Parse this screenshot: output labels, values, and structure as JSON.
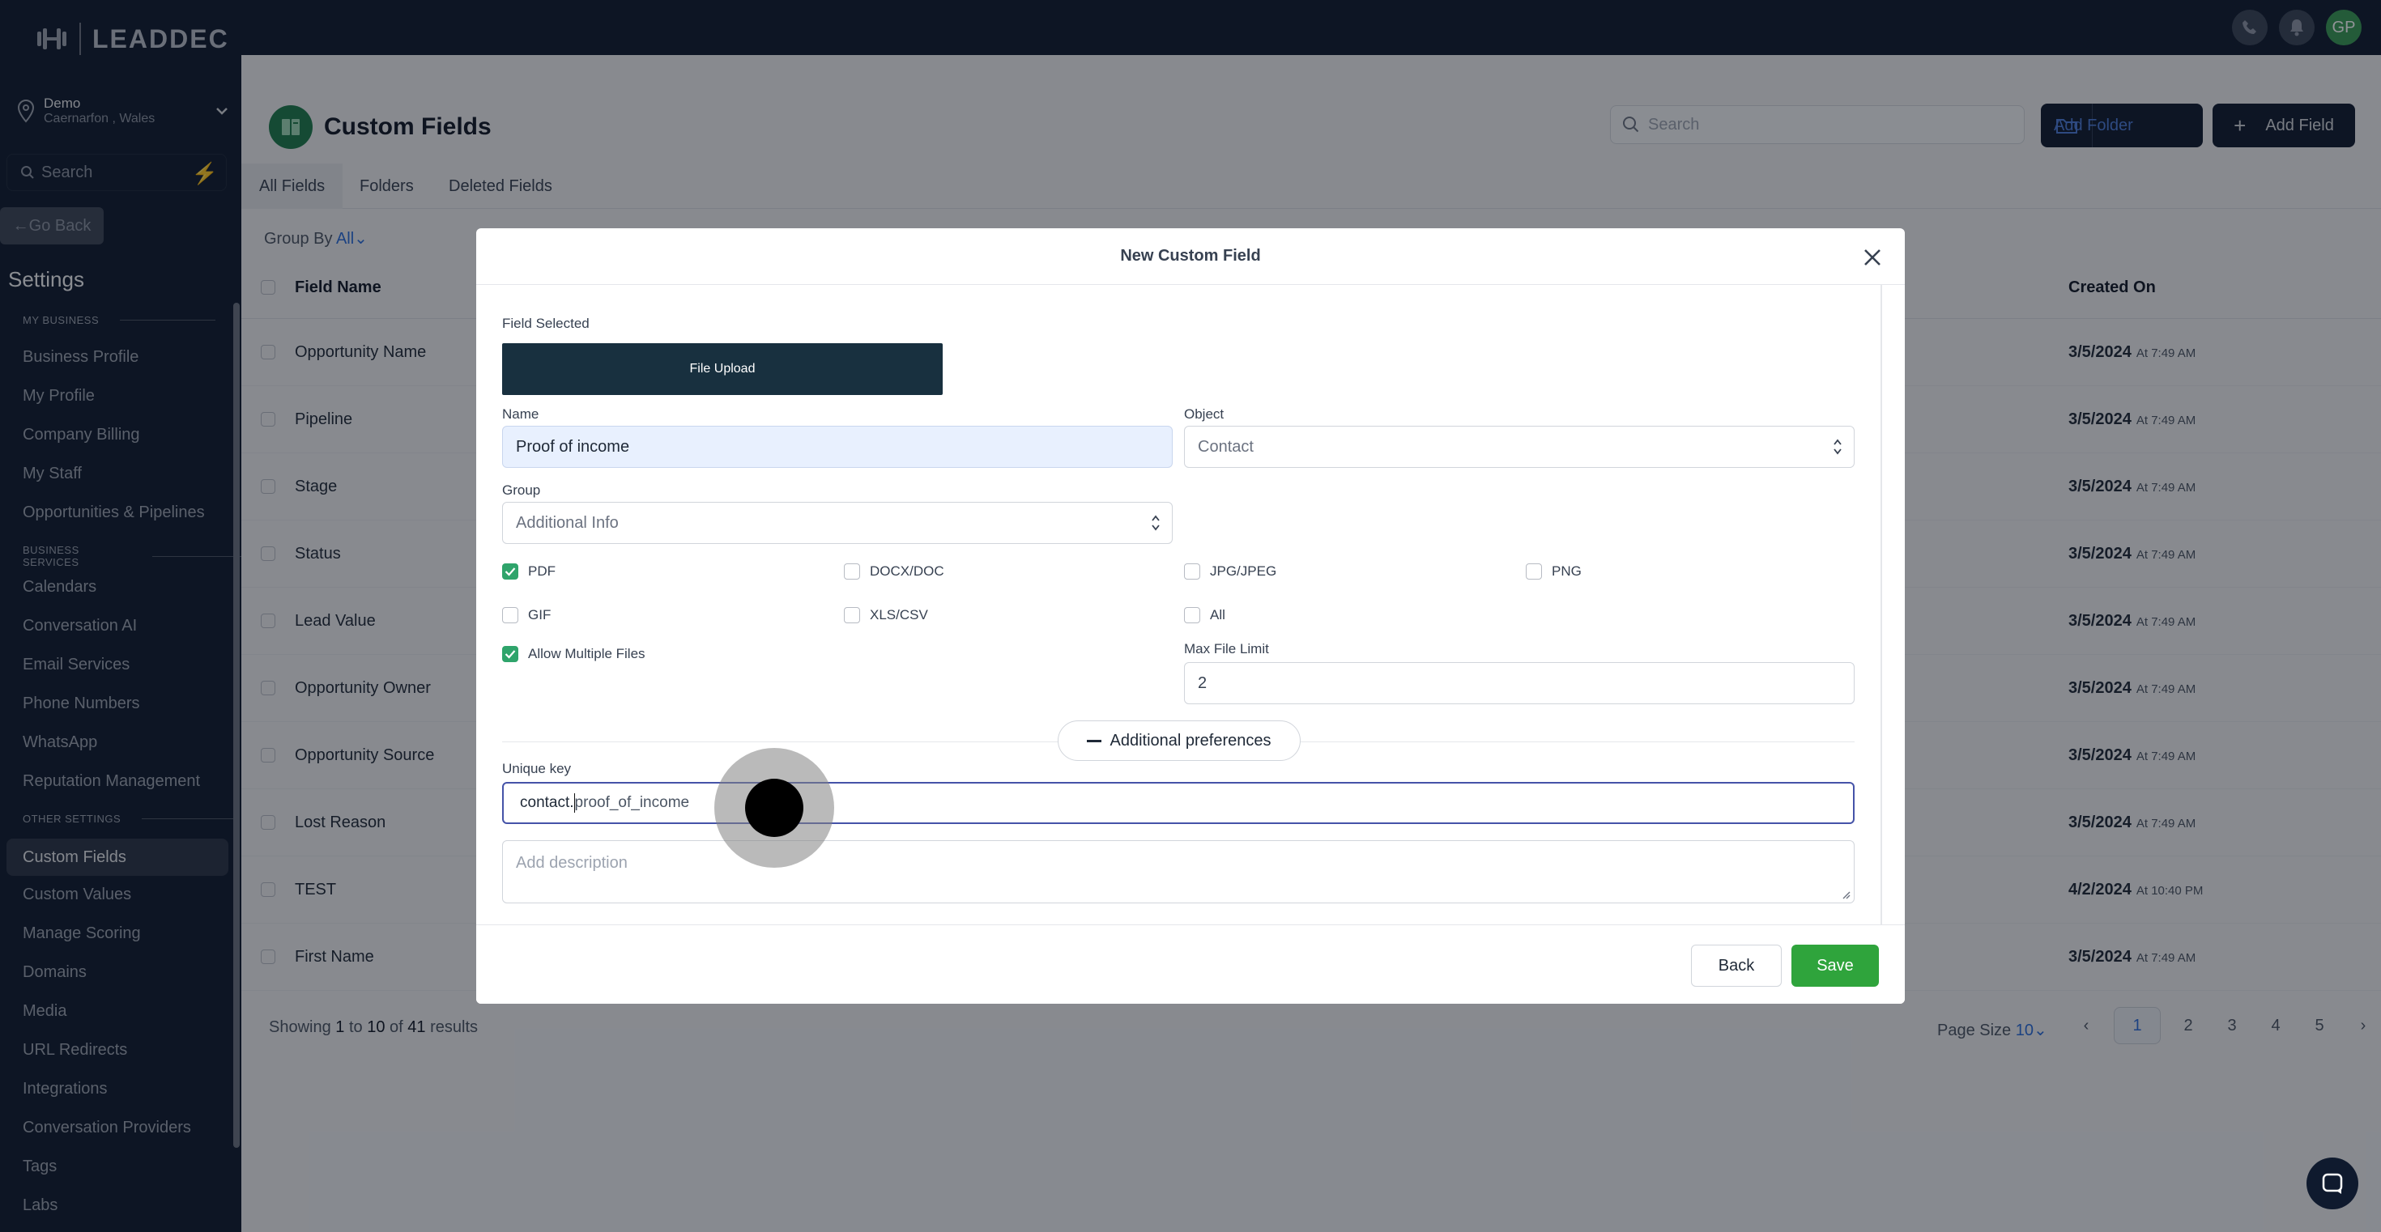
{
  "brand": {
    "logo_text": "LEADDEC"
  },
  "topbar": {
    "avatar_initials": "GP"
  },
  "sidebar": {
    "location_name": "Demo",
    "location_sub": "Caernarfon , Wales",
    "search_placeholder": "Search",
    "go_back": "Go Back",
    "settings_title": "Settings",
    "sections": {
      "my_business": "MY BUSINESS",
      "business_services": "BUSINESS SERVICES",
      "other_settings": "OTHER SETTINGS"
    },
    "items": [
      "Business Profile",
      "My Profile",
      "Company Billing",
      "My Staff",
      "Opportunities & Pipelines",
      "Calendars",
      "Conversation AI",
      "Email Services",
      "Phone Numbers",
      "WhatsApp",
      "Reputation Management",
      "Custom Fields",
      "Custom Values",
      "Manage Scoring",
      "Domains",
      "Media",
      "URL Redirects",
      "Integrations",
      "Conversation Providers",
      "Tags",
      "Labs"
    ]
  },
  "page": {
    "title": "Custom Fields",
    "search_placeholder": "Search",
    "add_folder": "Add Folder",
    "add_field": "Add Field",
    "tabs": [
      "All Fields",
      "Folders",
      "Deleted Fields"
    ],
    "group_by_label": "Group By",
    "group_by_value": "All",
    "columns": {
      "field_name": "Field Name",
      "created_on": "Created On"
    },
    "rows": [
      {
        "name": "Opportunity Name",
        "date": "3/5/2024",
        "time": "At 7:49 AM"
      },
      {
        "name": "Pipeline",
        "date": "3/5/2024",
        "time": "At 7:49 AM"
      },
      {
        "name": "Stage",
        "date": "3/5/2024",
        "time": "At 7:49 AM"
      },
      {
        "name": "Status",
        "date": "3/5/2024",
        "time": "At 7:49 AM"
      },
      {
        "name": "Lead Value",
        "date": "3/5/2024",
        "time": "At 7:49 AM"
      },
      {
        "name": "Opportunity Owner",
        "date": "3/5/2024",
        "time": "At 7:49 AM"
      },
      {
        "name": "Opportunity Source",
        "date": "3/5/2024",
        "time": "At 7:49 AM"
      },
      {
        "name": "Lost Reason",
        "date": "3/5/2024",
        "time": "At 7:49 AM"
      },
      {
        "name": "TEST",
        "date": "4/2/2024",
        "time": "At 10:40 PM"
      },
      {
        "name": "First Name",
        "date": "3/5/2024",
        "time": "At 7:49 AM"
      }
    ],
    "showing": {
      "prefix": "Showing",
      "from": "1",
      "to_word": "to",
      "to": "10",
      "of_word": "of",
      "total": "41",
      "suffix": "results"
    },
    "page_size_label": "Page Size",
    "page_size_value": "10",
    "pages": [
      "1",
      "2",
      "3",
      "4",
      "5"
    ]
  },
  "modal": {
    "title": "New Custom Field",
    "field_selected_label": "Field Selected",
    "field_type": "File Upload",
    "name_label": "Name",
    "name_value": "Proof of income",
    "object_label": "Object",
    "object_value": "Contact",
    "group_label": "Group",
    "group_value": "Additional Info",
    "file_types": [
      {
        "label": "PDF",
        "checked": true
      },
      {
        "label": "DOCX/DOC",
        "checked": false
      },
      {
        "label": "JPG/JPEG",
        "checked": false
      },
      {
        "label": "PNG",
        "checked": false
      },
      {
        "label": "GIF",
        "checked": false
      },
      {
        "label": "XLS/CSV",
        "checked": false
      },
      {
        "label": "All",
        "checked": false
      }
    ],
    "allow_multiple_label": "Allow Multiple Files",
    "allow_multiple_checked": true,
    "max_file_limit_label": "Max File Limit",
    "max_file_limit_value": "2",
    "additional_preferences": "Additional preferences",
    "unique_key_label": "Unique key",
    "unique_key_prefix": "contact.",
    "unique_key_value": "proof_of_income",
    "description_placeholder": "Add description",
    "back_label": "Back",
    "save_label": "Save"
  },
  "colors": {
    "accent_green": "#2fa43c",
    "link_blue": "#2b6cd9",
    "navy": "#0f1a2e"
  }
}
